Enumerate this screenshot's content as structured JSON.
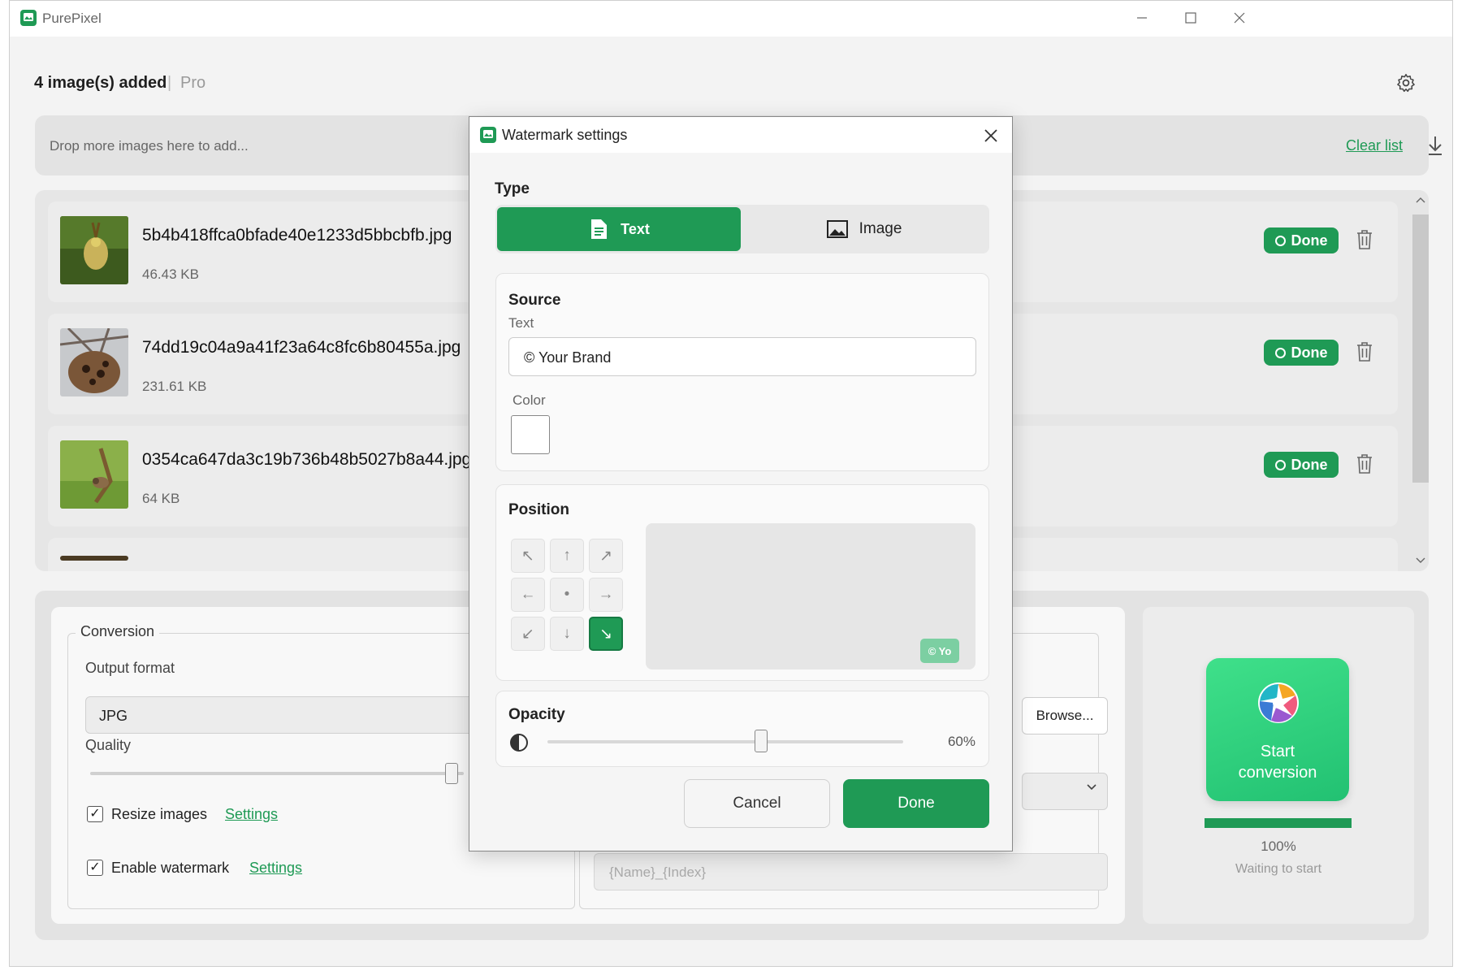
{
  "app": {
    "title": "PurePixel"
  },
  "header": {
    "count": "4 image(s) added",
    "separator": "|",
    "tier": "Pro"
  },
  "dropzone": {
    "text": "Drop more images here to add...",
    "clear_label": "Clear list"
  },
  "files": [
    {
      "name": "5b4b418ffca0bfade40e1233d5bbcbfb.jpg",
      "size": "46.43 KB",
      "status": "Done"
    },
    {
      "name": "74dd19c04a9a41f23a64c8fc6b80455a.jpg",
      "size": "231.61 KB",
      "status": "Done"
    },
    {
      "name": "0354ca647da3c19b736b48b5027b8a44.jpg",
      "size": "64 KB",
      "status": "Done"
    }
  ],
  "conversion": {
    "legend": "Conversion",
    "output_format_label": "Output format",
    "output_format_value": "JPG",
    "quality_label": "Quality",
    "resize_label": "Resize images",
    "resize_checked": true,
    "watermark_label": "Enable watermark",
    "watermark_checked": true,
    "settings_link": "Settings",
    "check_mark": "✓",
    "browse_label": "Browse...",
    "name_placeholder": "{Name}_{Index}"
  },
  "start": {
    "label_line1": "Start",
    "label_line2": "conversion",
    "progress": 1.0,
    "percent_text": "100%",
    "status_text": "Waiting to start"
  },
  "modal": {
    "title": "Watermark settings",
    "type_label": "Type",
    "type_options": {
      "text": "Text",
      "image": "Image"
    },
    "type_selected": "Text",
    "source_label": "Source",
    "text_label": "Text",
    "text_value": "© Your Brand",
    "color_label": "Color",
    "color_value": "#ffffff",
    "position_label": "Position",
    "position_selected": "bottom-right",
    "preview_badge": "© Yo",
    "opacity_label": "Opacity",
    "opacity_value": 0.6,
    "opacity_text": "60%",
    "cancel_label": "Cancel",
    "done_label": "Done"
  },
  "colors": {
    "accent": "#1f9a55",
    "start_button": "#2fd07f"
  }
}
